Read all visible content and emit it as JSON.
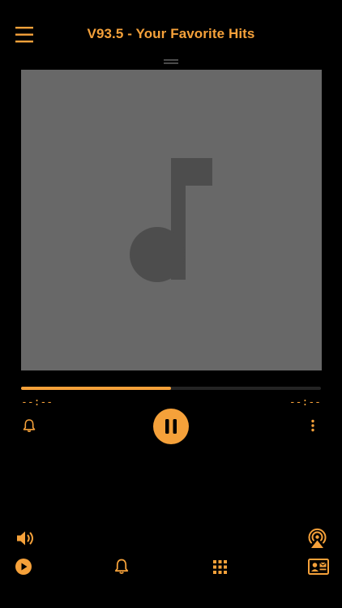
{
  "header": {
    "title": "V93.5 - Your Favorite Hits",
    "menu_icon": "hamburger-menu-icon"
  },
  "artwork": {
    "placeholder_icon": "music-note-icon"
  },
  "player": {
    "progress": 0.5,
    "elapsed": "--:--",
    "remaining": "--:--",
    "state": "playing",
    "play_pause_icon": "pause-icon"
  },
  "controls": {
    "alarm_icon": "bell-icon",
    "more_icon": "more-vertical-icon",
    "volume_icon": "volume-icon",
    "airplay_icon": "airplay-audio-icon"
  },
  "tabs": [
    {
      "icon": "play-circle-icon"
    },
    {
      "icon": "bell-icon"
    },
    {
      "icon": "grid-icon"
    },
    {
      "icon": "contact-card-icon"
    }
  ],
  "colors": {
    "accent": "#F5A13A",
    "background": "#000000",
    "artwork_bg": "#686868",
    "note": "#4D4D4D",
    "track": "#242424"
  }
}
